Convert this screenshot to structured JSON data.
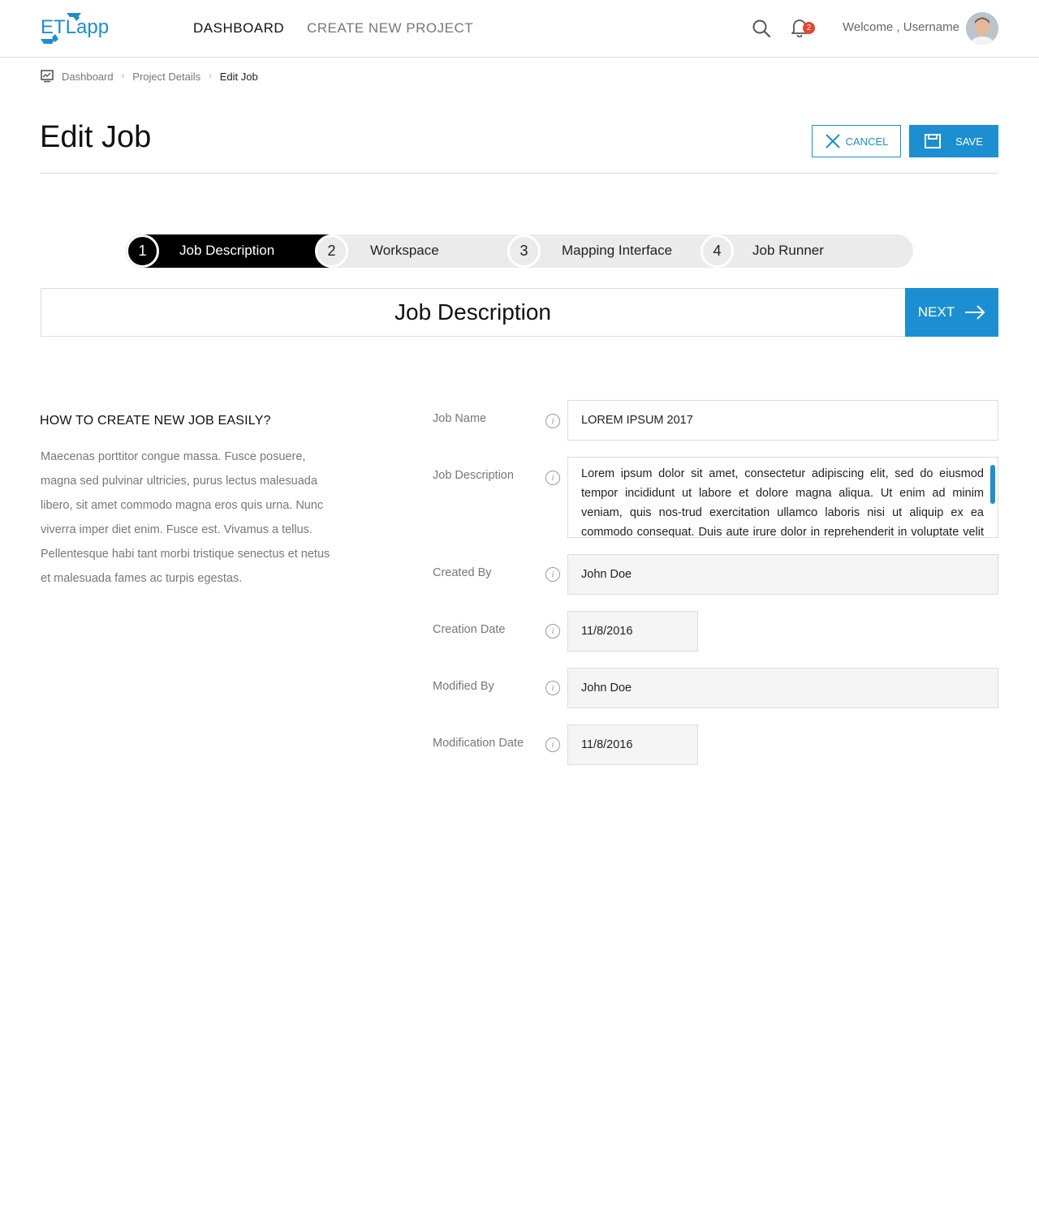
{
  "header": {
    "logo_text_etl": "ETL",
    "logo_text_app": "app",
    "nav": [
      {
        "label": "DASHBOARD"
      },
      {
        "label": "CREATE NEW PROJECT"
      }
    ],
    "notification_count": "2",
    "welcome": "Welcome , Username"
  },
  "breadcrumb": {
    "items": [
      "Dashboard",
      "Project Details"
    ],
    "current": "Edit Job",
    "separator": "›"
  },
  "page": {
    "title": "Edit Job",
    "cancel_label": "CANCEL",
    "save_label": "SAVE"
  },
  "stepper": {
    "steps": [
      {
        "number": "1",
        "label": "Job Description",
        "active": true
      },
      {
        "number": "2",
        "label": "Workspace",
        "active": false
      },
      {
        "number": "3",
        "label": "Mapping Interface",
        "active": false
      },
      {
        "number": "4",
        "label": "Job Runner",
        "active": false
      }
    ]
  },
  "section": {
    "title": "Job Description",
    "next_label": "NEXT"
  },
  "help": {
    "title": "HOW TO CREATE NEW JOB EASILY?",
    "text": "Maecenas porttitor congue massa. Fusce posuere, magna sed pulvinar ultricies, purus lectus malesuada libero, sit amet commodo magna eros quis urna. Nunc viverra imper diet enim. Fusce est. Vivamus a tellus. Pellentesque habi tant morbi tristique senectus et netus et malesuada fames ac turpis egestas."
  },
  "form": {
    "job_name": {
      "label": "Job Name",
      "value": "LOREM IPSUM 2017"
    },
    "job_description": {
      "label": "Job Description",
      "value": "Lorem ipsum dolor sit amet, consectetur adipiscing elit, sed do eiusmod tempor incididunt ut labore et dolore magna aliqua. Ut enim ad minim veniam, quis nos-trud exercitation ullamco laboris nisi ut aliquip ex ea commodo consequat. Duis aute irure dolor in reprehenderit in voluptate velit esse cillum dolore eu fugiat"
    },
    "created_by": {
      "label": "Created By",
      "value": "John Doe"
    },
    "creation_date": {
      "label": "Creation Date",
      "value": "11/8/2016"
    },
    "modified_by": {
      "label": "Modified By",
      "value": "John Doe"
    },
    "modification_date": {
      "label": "Modification Date",
      "value": "11/8/2016"
    },
    "info_glyph": "i"
  },
  "colors": {
    "accent": "#1b8fd2",
    "badge": "#e8452c",
    "active_step": "#000000",
    "inactive_step": "#ebebeb"
  },
  "icons": [
    "logo-arrows-icon",
    "search-icon",
    "bell-icon",
    "dashboard-icon",
    "close-icon",
    "save-icon",
    "arrow-right-icon",
    "info-icon"
  ]
}
